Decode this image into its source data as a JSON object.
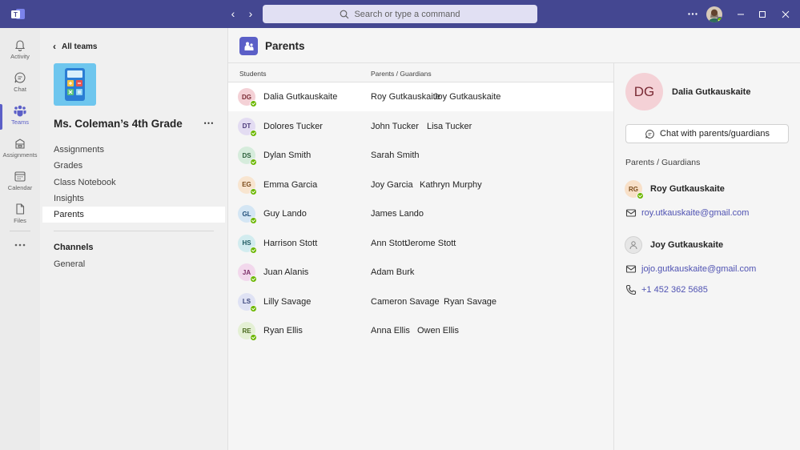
{
  "titlebar": {
    "search_placeholder": "Search or type a command"
  },
  "rail": {
    "items": [
      {
        "label": "Activity",
        "icon": "bell-icon"
      },
      {
        "label": "Chat",
        "icon": "chat-icon"
      },
      {
        "label": "Teams",
        "icon": "teams-icon"
      },
      {
        "label": "Assignments",
        "icon": "assignments-icon"
      },
      {
        "label": "Calendar",
        "icon": "calendar-icon"
      },
      {
        "label": "Files",
        "icon": "files-icon"
      }
    ],
    "active": "Teams"
  },
  "team_panel": {
    "back_label": "All teams",
    "team_name": "Ms. Coleman’s 4th Grade",
    "nav": [
      "Assignments",
      "Grades",
      "Class Notebook",
      "Insights",
      "Parents"
    ],
    "active_nav": "Parents",
    "channels_heading": "Channels",
    "channels": [
      "General"
    ]
  },
  "main": {
    "title": "Parents",
    "columns": {
      "students": "Students",
      "parents": "Parents / Guardians"
    },
    "rows": [
      {
        "initials": "DG",
        "student": "Dalia Gutkauskaite",
        "p1": "Roy Gutkauskaite",
        "p2": "Joy Gutkauskaite",
        "bg": "#f4d1d6",
        "fg": "#7a2b35"
      },
      {
        "initials": "DT",
        "student": "Dolores Tucker",
        "p1": "John Tucker",
        "p2": "Lisa Tucker",
        "bg": "#e3dcf2",
        "fg": "#4b3a7a"
      },
      {
        "initials": "DS",
        "student": "Dylan Smith",
        "p1": "Sarah Smith",
        "p2": "",
        "bg": "#d6ecdc",
        "fg": "#2b5e3a"
      },
      {
        "initials": "EG",
        "student": "Emma Garcia",
        "p1": "Joy Garcia",
        "p2": "Kathryn Murphy",
        "bg": "#f8e5d0",
        "fg": "#7a4a1a"
      },
      {
        "initials": "GL",
        "student": "Guy Lando",
        "p1": "James Lando",
        "p2": "",
        "bg": "#d4e6f4",
        "fg": "#1f4e79"
      },
      {
        "initials": "HS",
        "student": "Harrison Stott",
        "p1": "Ann Stott",
        "p2": "Jerome Stott",
        "bg": "#d2ecef",
        "fg": "#1e5a60"
      },
      {
        "initials": "JA",
        "student": "Juan Alanis",
        "p1": "Adam Burk",
        "p2": "",
        "bg": "#f2d8ec",
        "fg": "#7a2b65"
      },
      {
        "initials": "LS",
        "student": "Lilly Savage",
        "p1": "Cameron Savage",
        "p2": "Ryan Savage",
        "bg": "#dfe2f4",
        "fg": "#3a447a"
      },
      {
        "initials": "RE",
        "student": "Ryan Ellis",
        "p1": "Anna Ellis",
        "p2": "Owen Ellis",
        "bg": "#e4f0d4",
        "fg": "#4a6a1f"
      }
    ]
  },
  "detail": {
    "initials": "DG",
    "name": "Dalia Gutkauskaite",
    "chat_button": "Chat with parents/guardians",
    "section": "Parents / Guardians",
    "guardian1": {
      "initials": "RG",
      "name": "Roy Gutkauskaite",
      "email": "roy.utkauskaite@gmail.com"
    },
    "guardian2": {
      "name": "Joy Gutkauskaite",
      "email": "jojo.gutkauskaite@gmail.com",
      "phone": "+1 452 362 5685"
    }
  },
  "colors": {
    "titlebar": "#444791",
    "accent": "#5b5fc7",
    "link": "#4f52b2",
    "presence_available": "#6bb700"
  }
}
